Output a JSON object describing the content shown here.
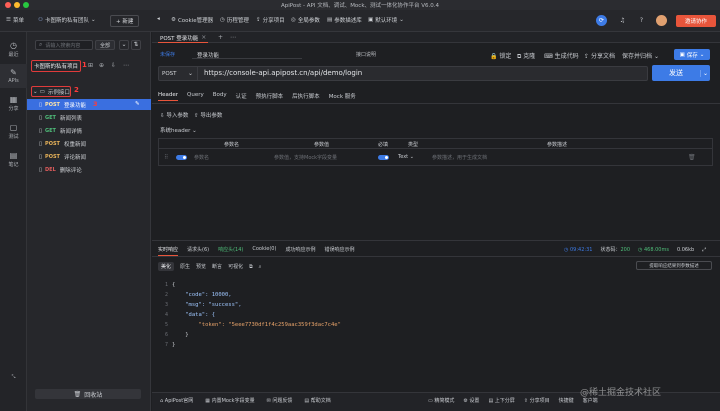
{
  "window": {
    "title": "ApiPost - API 文档、调试、Mock、测试一体化协作平台 V6.0.4"
  },
  "topnav": {
    "menu": "菜单",
    "team": "卡图斯的私有团队",
    "new_btn": "+ 新建",
    "links": [
      "Cookie管理器",
      "历程管理",
      "分享项目",
      "全局参数",
      "参数描述库",
      "默认环境"
    ],
    "invite_btn": "邀请协作"
  },
  "rail": {
    "items": [
      "最近",
      "APIs",
      "分享",
      "测试",
      "笔记"
    ]
  },
  "sidebar": {
    "search_placeholder": "请输入搜索内容",
    "filter": "全部",
    "project": "卡图斯的私有项目",
    "folder": "示例接口",
    "items": [
      {
        "method": "POST",
        "name": "登录功能",
        "color": "#e8b35a"
      },
      {
        "method": "GET",
        "name": "新闻列表",
        "color": "#4fbf7a"
      },
      {
        "method": "GET",
        "name": "新闻详情",
        "color": "#4fbf7a"
      },
      {
        "method": "POST",
        "name": "权重新闻",
        "color": "#e8b35a"
      },
      {
        "method": "POST",
        "name": "评论新闻",
        "color": "#e8b35a"
      },
      {
        "method": "DEL",
        "name": "删除评论",
        "color": "#e05c5c"
      }
    ],
    "recycle": "回收站",
    "annotations": [
      "1",
      "2",
      "3"
    ]
  },
  "tabs": {
    "active": "POST 登录功能"
  },
  "request": {
    "mode": "未保存",
    "name": "登录功能",
    "doc_type": "接口说明",
    "actions": [
      "锁定",
      "克隆",
      "生成代码",
      "分享文档",
      "保存并归档"
    ],
    "save_btn": "保存",
    "method": "POST",
    "url": "https://console-api.apipost.cn/api/demo/login",
    "send_btn": "发送"
  },
  "req_tabs": [
    "Header",
    "Query",
    "Body",
    "认证",
    "预执行脚本",
    "后执行脚本",
    "Mock 服务"
  ],
  "header_tools": {
    "import": "导入参数",
    "export": "导出参数",
    "system": "系统header"
  },
  "param_table": {
    "columns": [
      "参数名",
      "参数值",
      "必填",
      "类型",
      "参数描述"
    ],
    "row": {
      "name_ph": "参数名",
      "value_ph": "参数值，支持Mock字段变量",
      "type": "Text",
      "desc_ph": "参数描述，用于生成文档"
    }
  },
  "response": {
    "tabs": [
      "实时响应",
      "请求头(6)",
      "响应头(14)",
      "Cookie(0)",
      "成功响应示例",
      "错误响应示例"
    ],
    "time": "09:42:31",
    "status_label": "状态码：",
    "status": "200",
    "duration": "468.00ms",
    "size": "0.06kb",
    "view_tabs": [
      "美化",
      "原生",
      "预览",
      "断言",
      "可视化"
    ],
    "extract_btn": "提取响应结果到参数描述",
    "code_lines": [
      "{",
      "    \"code\": 10000,",
      "    \"msg\": \"success\",",
      "    \"data\": {",
      "        \"token\": \"5eee7730df1f4c259aac359f3dac7c4e\"",
      "    }",
      "}"
    ]
  },
  "footer": {
    "links": [
      "ApiPost官网",
      "内置Mock字段变量",
      "问题反馈",
      "帮助文档"
    ],
    "right": [
      "精简模式",
      "设置",
      "上下分屏",
      "分享项目",
      "快捷键",
      "客户端"
    ],
    "watermark": "@稀土掘金技术社区"
  }
}
